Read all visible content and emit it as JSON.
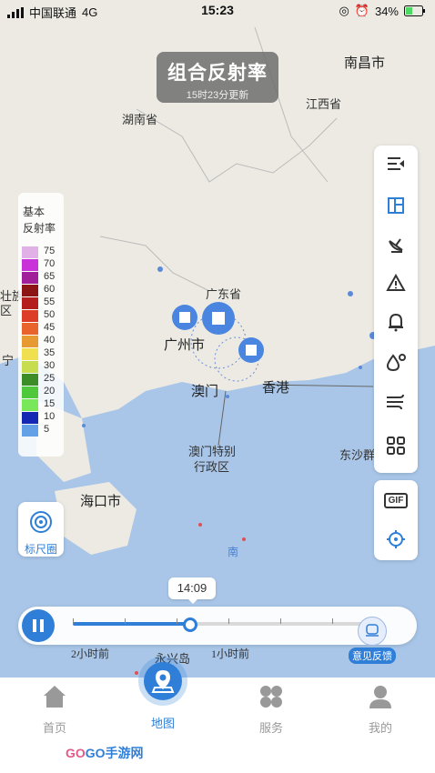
{
  "status_bar": {
    "carrier": "中国联通",
    "network": "4G",
    "time": "15:23",
    "battery": "34%"
  },
  "header": {
    "title": "组合反射率",
    "subtitle": "15时23分更新"
  },
  "map": {
    "labels": {
      "nanchang": "南昌市",
      "hunan": "湖南省",
      "jiangxi": "江西省",
      "guangdong": "广东省",
      "guangzhou": "广州市",
      "macau": "澳门",
      "hongkong": "香港",
      "macau_sar": "澳门特别",
      "macau_sar2": "行政区",
      "haikou": "海口市",
      "dongsha": "东沙群",
      "yongxing": "永兴岛",
      "nan": "南",
      "left1": "壮族",
      "left2": "区",
      "left3": "宁"
    }
  },
  "legend": {
    "title_line1": "基本",
    "title_line2": "反射率",
    "items": [
      {
        "value": "75",
        "color": "#e0b0e6"
      },
      {
        "value": "70",
        "color": "#c832d8"
      },
      {
        "value": "65",
        "color": "#a01e9a"
      },
      {
        "value": "60",
        "color": "#8c1414"
      },
      {
        "value": "55",
        "color": "#b41e1e"
      },
      {
        "value": "50",
        "color": "#dc3c28"
      },
      {
        "value": "45",
        "color": "#e8642c"
      },
      {
        "value": "40",
        "color": "#e89a32"
      },
      {
        "value": "35",
        "color": "#f0e050"
      },
      {
        "value": "30",
        "color": "#c8dc50"
      },
      {
        "value": "25",
        "color": "#3c8c28"
      },
      {
        "value": "20",
        "color": "#50c83c"
      },
      {
        "value": "15",
        "color": "#78e85a"
      },
      {
        "value": "10",
        "color": "#1428b4"
      },
      {
        "value": "5",
        "color": "#64a0e6"
      }
    ]
  },
  "ruler": {
    "label": "标尺圈"
  },
  "toolbar": {
    "gif_label": "GIF"
  },
  "player": {
    "current_time": "14:09",
    "label_2h": "2小时前",
    "label_1h": "1小时前",
    "progress": 0.38
  },
  "feedback": {
    "label": "意见反馈"
  },
  "tabs": [
    {
      "label": "首页"
    },
    {
      "label": "地图"
    },
    {
      "label": "服务"
    },
    {
      "label": "我的"
    }
  ],
  "watermark": {
    "brand_a": "GO",
    "brand_b": "GO",
    "brand_c": "手游网"
  }
}
